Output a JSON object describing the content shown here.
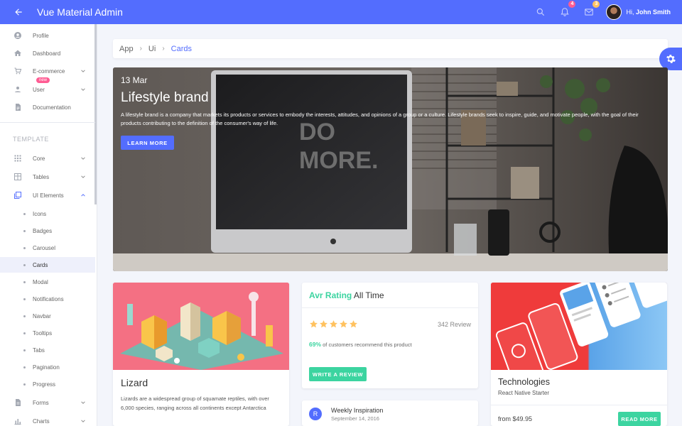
{
  "app": {
    "title": "Vue Material Admin"
  },
  "header": {
    "notifications_count": "4",
    "messages_count": "3",
    "greeting": "Hi,",
    "user_name": "John Smith",
    "colors": {
      "primary": "#536dfe",
      "notif_badge": "#ff5c93",
      "msg_badge": "#ffc260"
    }
  },
  "sidebar": {
    "items": [
      {
        "label": "Profile",
        "icon": "account-circle-icon"
      },
      {
        "label": "Dashboard",
        "icon": "home-icon"
      },
      {
        "label": "E-commerce",
        "icon": "cart-icon"
      },
      {
        "label": "User",
        "icon": "person-icon",
        "badge": "new"
      },
      {
        "label": "Documentation",
        "icon": "document-icon"
      }
    ],
    "section_title": "TEMPLATE",
    "template_items": [
      {
        "label": "Core",
        "icon": "grid-icon"
      },
      {
        "label": "Tables",
        "icon": "table-icon"
      },
      {
        "label": "UI Elements",
        "icon": "layers-icon"
      }
    ],
    "ui_elements_children": [
      "Icons",
      "Badges",
      "Carousel",
      "Cards",
      "Modal",
      "Notifications",
      "Navbar",
      "Tooltips",
      "Tabs",
      "Pagination",
      "Progress"
    ],
    "bottom_items": [
      {
        "label": "Forms",
        "icon": "form-icon"
      },
      {
        "label": "Charts",
        "icon": "chart-icon"
      }
    ]
  },
  "breadcrumb": [
    "App",
    "Ui",
    "Cards"
  ],
  "hero": {
    "date": "13 Mar",
    "title": "Lifestyle brand",
    "text": "A lifestyle brand is a company that markets its products or services to embody the interests, attitudes, and opinions of a group or a culture. Lifestyle brands seek to inspire, guide, and motivate people, with the goal of their products contributing to the definition of the consumer's way of life.",
    "button": "LEARN MORE",
    "screen_text_1": "DO",
    "screen_text_2": "MORE."
  },
  "lizard": {
    "title": "Lizard",
    "text": "Lizards are a widespread group of squamate reptiles, with over 6,000 species, ranging across all continents except Antarctica"
  },
  "rating": {
    "accent": "Avr Rating",
    "rest": "All Time",
    "stars": 5,
    "reviews": "342 Review",
    "percent": "69%",
    "recommend_text": "of customers recommend this product",
    "button": "WRITE A REVIEW",
    "colors": {
      "star": "#ffc260",
      "accent": "#3cd4a0"
    }
  },
  "weekly": {
    "avatar_letter": "R",
    "title": "Weekly Inspiration",
    "date": "September 14, 2016"
  },
  "technologies": {
    "title": "Technologies",
    "subtitle": "React Native Starter",
    "price": "from $49.95",
    "button": "READ MORE"
  }
}
